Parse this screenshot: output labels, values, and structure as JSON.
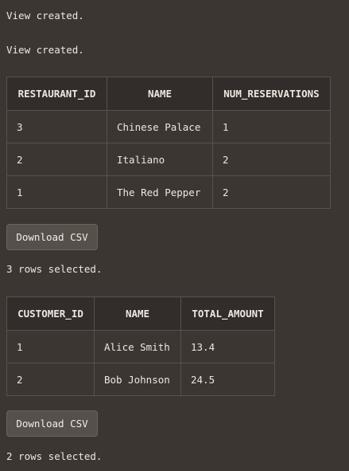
{
  "messages": {
    "view_created_1": "View created.",
    "view_created_2": "View created.",
    "rows_selected_1": "3 rows selected.",
    "rows_selected_2": "2 rows selected."
  },
  "table1": {
    "headers": [
      "RESTAURANT_ID",
      "NAME",
      "NUM_RESERVATIONS"
    ],
    "rows": [
      [
        "3",
        "Chinese Palace",
        "1"
      ],
      [
        "2",
        "Italiano",
        "2"
      ],
      [
        "1",
        "The Red Pepper",
        "2"
      ]
    ]
  },
  "table2": {
    "headers": [
      "CUSTOMER_ID",
      "NAME",
      "TOTAL_AMOUNT"
    ],
    "rows": [
      [
        "1",
        "Alice Smith",
        "13.4"
      ],
      [
        "2",
        "Bob Johnson",
        "24.5"
      ]
    ]
  },
  "buttons": {
    "download_csv_1": "Download CSV",
    "download_csv_2": "Download CSV"
  }
}
